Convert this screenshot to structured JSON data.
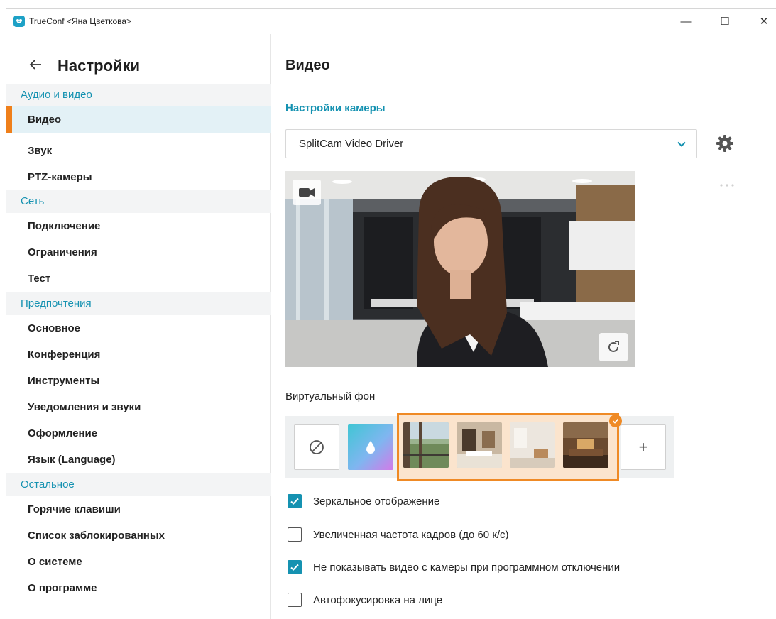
{
  "window": {
    "title": "TrueConf <Яна Цветкова>",
    "controls": {
      "minimize": "—",
      "maximize": "☐",
      "close": "✕"
    }
  },
  "sidebar": {
    "title": "Настройки",
    "groups": [
      {
        "header": "Аудио и видео",
        "items": [
          "Видео",
          "Звук",
          "PTZ-камеры"
        ]
      },
      {
        "header": "Сеть",
        "items": [
          "Подключение",
          "Ограничения",
          "Тест"
        ]
      },
      {
        "header": "Предпочтения",
        "items": [
          "Основное",
          "Конференция",
          "Инструменты",
          "Уведомления и звуки",
          "Оформление",
          "Язык (Language)"
        ]
      },
      {
        "header": "Остальное",
        "items": [
          "Горячие клавиши",
          "Список заблокированных",
          "О системе",
          "О программе"
        ]
      }
    ],
    "active_item": "Видео"
  },
  "main": {
    "title": "Видео",
    "camera_section": "Настройки камеры",
    "camera_select_value": "SplitCam Video Driver",
    "virtual_bg_label": "Виртуальный фон",
    "options": [
      {
        "label": "Зеркальное отображение",
        "checked": true
      },
      {
        "label": "Увеличенная частота кадров (до 60 к/с)",
        "checked": false
      },
      {
        "label": "Не показывать видео с камеры при программном отключении",
        "checked": true
      },
      {
        "label": "Автофокусировка на лице",
        "checked": false
      }
    ],
    "add_bg": "+"
  },
  "colors": {
    "accent": "#1592b1",
    "active_marker": "#ef7f1a",
    "selection": "#ef8a25",
    "active_bg": "#e3f1f6",
    "group_bg": "#f3f4f5"
  },
  "icons": [
    "app-logo-icon",
    "back-arrow-icon",
    "chevron-down-icon",
    "gear-icon",
    "more-dots-icon",
    "camera-icon",
    "rotate-icon",
    "no-background-icon",
    "blur-drop-icon",
    "check-icon",
    "plus-icon"
  ]
}
